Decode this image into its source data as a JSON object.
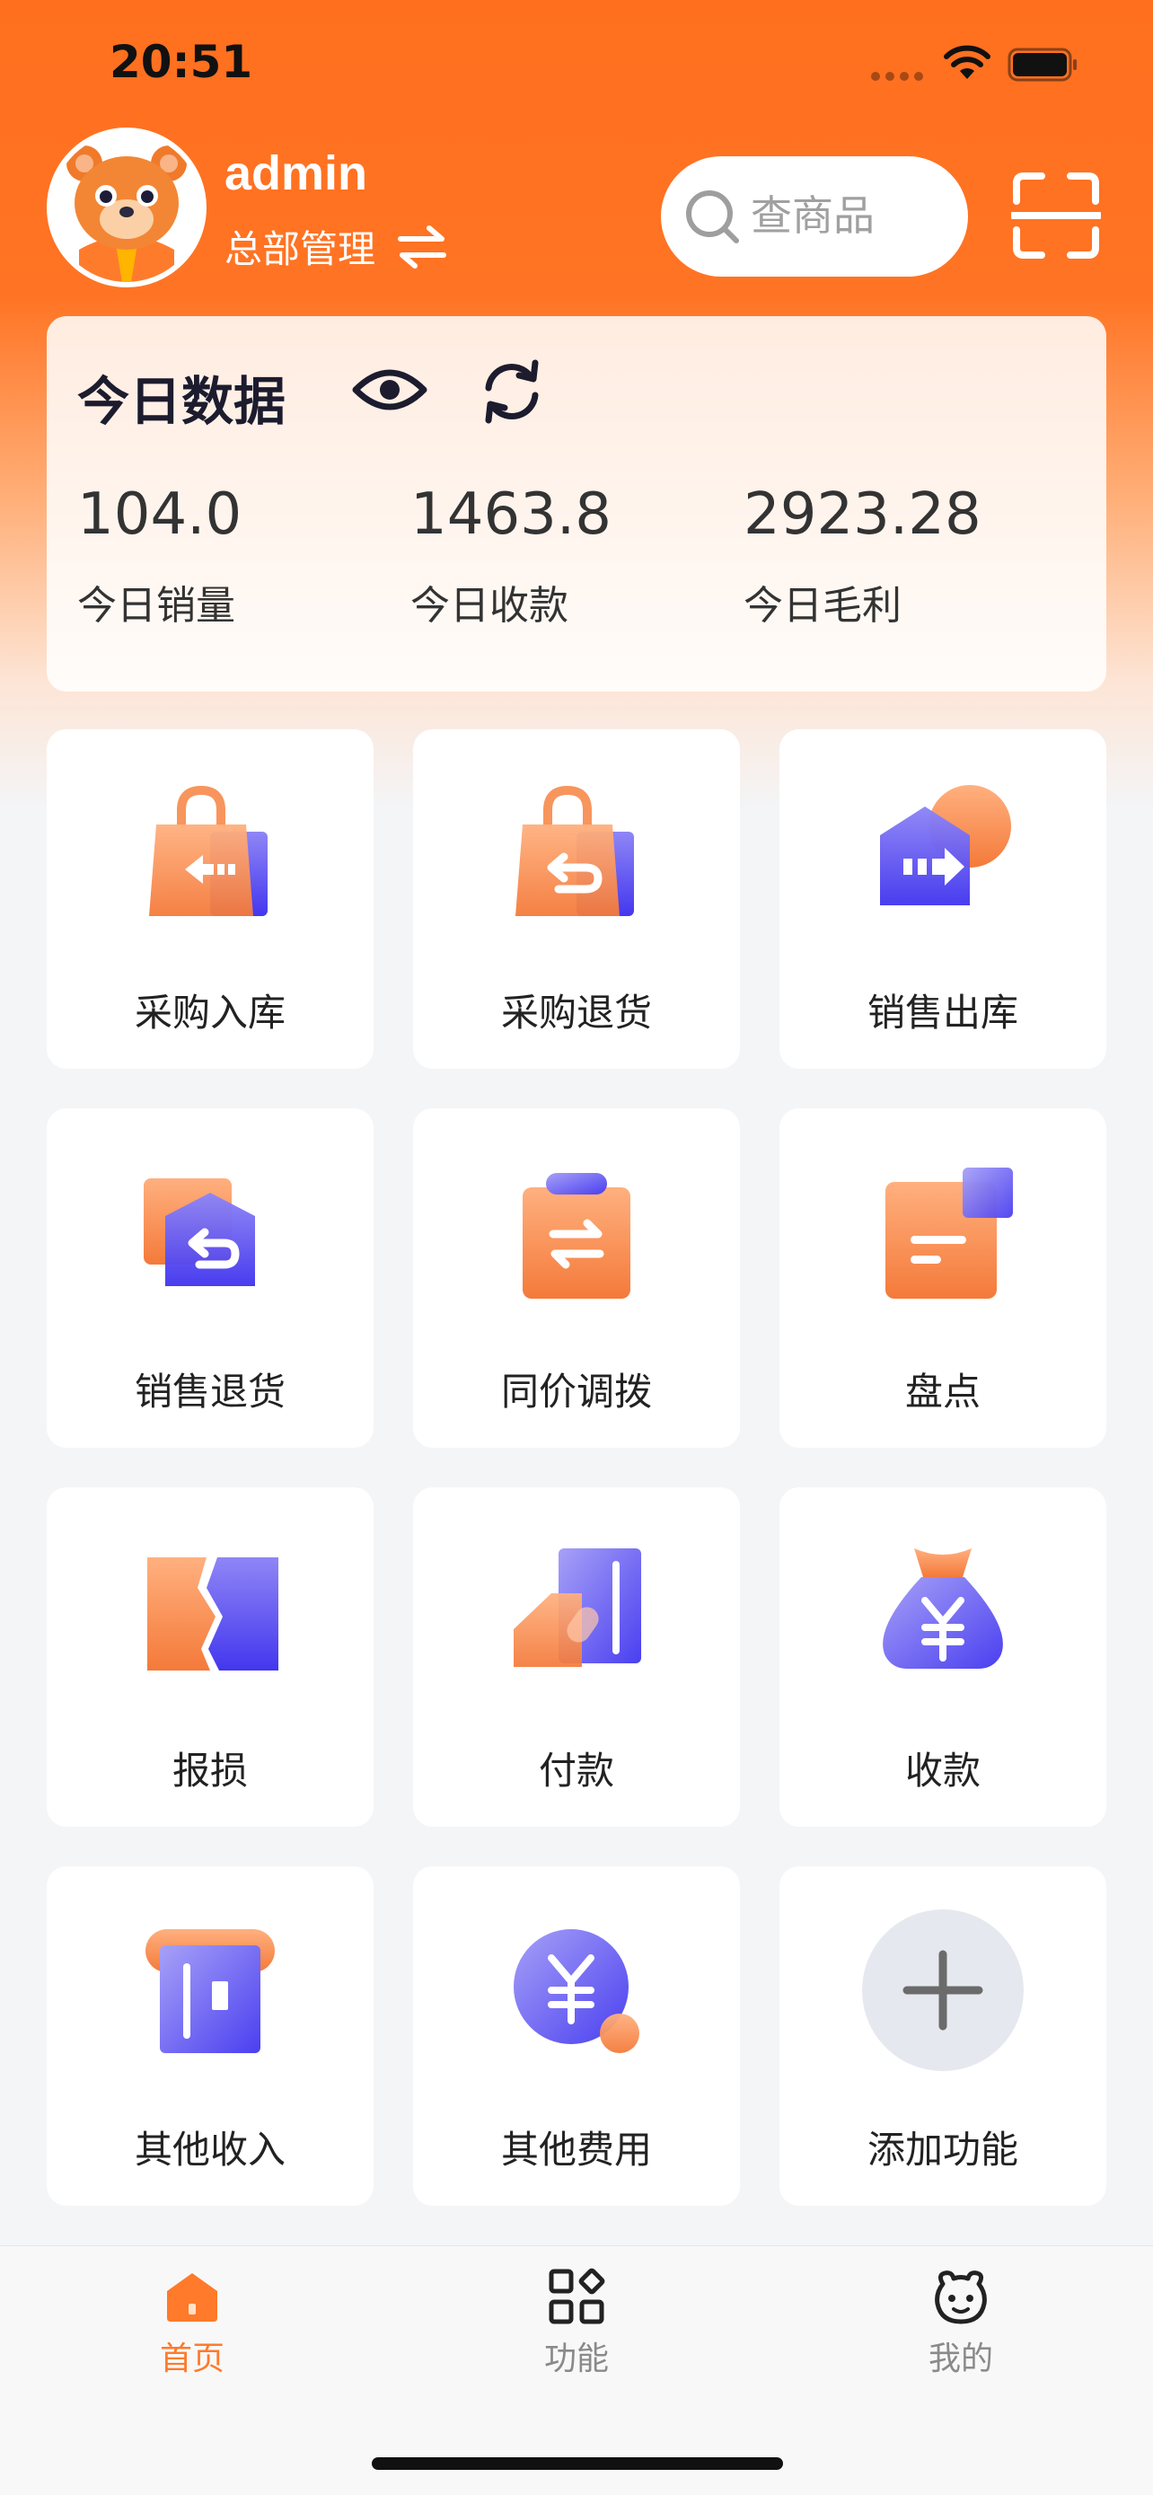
{
  "status_bar": {
    "time": "20:51"
  },
  "header": {
    "username": "admin",
    "role": "总部管理",
    "search_placeholder": "查商品"
  },
  "today": {
    "title": "今日数据",
    "stats": [
      {
        "value": "104.0",
        "label": "今日销量"
      },
      {
        "value": "1463.8",
        "label": "今日收款"
      },
      {
        "value": "2923.28",
        "label": "今日毛利"
      }
    ]
  },
  "functions": [
    {
      "label": "采购入库",
      "icon": "purchase-in-icon"
    },
    {
      "label": "采购退货",
      "icon": "purchase-return-icon"
    },
    {
      "label": "销售出库",
      "icon": "sales-out-icon"
    },
    {
      "label": "销售退货",
      "icon": "sales-return-icon"
    },
    {
      "label": "同价调拨",
      "icon": "transfer-icon"
    },
    {
      "label": "盘点",
      "icon": "inventory-check-icon"
    },
    {
      "label": "报损",
      "icon": "loss-report-icon"
    },
    {
      "label": "付款",
      "icon": "payment-icon"
    },
    {
      "label": "收款",
      "icon": "receipt-icon"
    },
    {
      "label": "其他收入",
      "icon": "other-income-icon"
    },
    {
      "label": "其他费用",
      "icon": "other-expense-icon"
    },
    {
      "label": "添加功能",
      "icon": "add-function-icon"
    }
  ],
  "tabbar": [
    {
      "label": "首页",
      "icon": "home-icon",
      "active": true
    },
    {
      "label": "功能",
      "icon": "apps-icon",
      "active": false
    },
    {
      "label": "我的",
      "icon": "profile-icon",
      "active": false
    }
  ],
  "colors": {
    "brand_orange": "#ff7424",
    "icon_purple": "#5a4cf2",
    "icon_orange": "#fb8a4e",
    "active_tab": "#ff7a2a"
  }
}
